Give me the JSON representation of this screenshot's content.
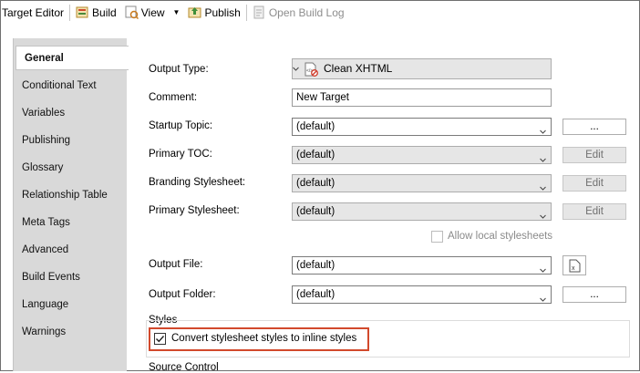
{
  "toolbar": {
    "title": "Target Editor",
    "build": "Build",
    "view": "View",
    "publish": "Publish",
    "open_build_log": "Open Build Log"
  },
  "nav": [
    "General",
    "Conditional Text",
    "Variables",
    "Publishing",
    "Glossary",
    "Relationship Table",
    "Meta Tags",
    "Advanced",
    "Build Events",
    "Language",
    "Warnings"
  ],
  "form": {
    "output_type_label": "Output Type:",
    "output_type_value": "Clean XHTML",
    "comment_label": "Comment:",
    "comment_value": "New Target",
    "startup_topic_label": "Startup Topic:",
    "startup_topic_value": "(default)",
    "primary_toc_label": "Primary TOC:",
    "primary_toc_value": "(default)",
    "branding_label": "Branding Stylesheet:",
    "branding_value": "(default)",
    "primary_stylesheet_label": "Primary Stylesheet:",
    "primary_stylesheet_value": "(default)",
    "allow_local_label": "Allow local stylesheets",
    "output_file_label": "Output File:",
    "output_file_value": "(default)",
    "output_folder_label": "Output Folder:",
    "output_folder_value": "(default)",
    "ellipsis": "...",
    "edit": "Edit",
    "styles_heading": "Styles",
    "convert_label": "Convert stylesheet styles to inline styles",
    "source_control_heading": "Source Control"
  },
  "colors": {
    "highlight": "#d2492c",
    "nav_bg": "#d9d9d9",
    "disabled_field": "#e6e6e6"
  }
}
